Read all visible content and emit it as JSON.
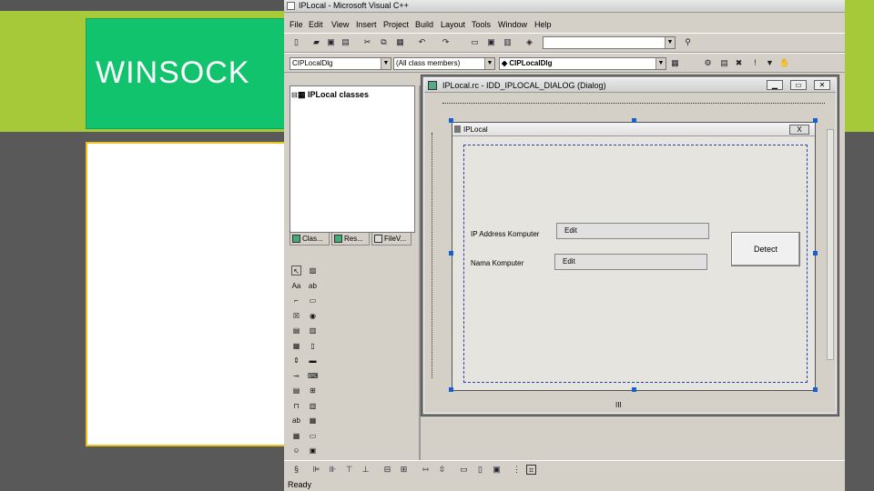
{
  "slide": {
    "title": "WINSOCK"
  },
  "app": {
    "title": "IPLocal - Microsoft Visual C++",
    "menu": [
      "File",
      "Edit",
      "View",
      "Insert",
      "Project",
      "Build",
      "Layout",
      "Tools",
      "Window",
      "Help"
    ],
    "toolbar2": {
      "class_combo": "CIPLocalDlg",
      "members_combo": "(All class members)",
      "method_combo": "CIPLocalDlg"
    },
    "workspace": {
      "tree_root": "IPLocal classes",
      "tabs": [
        "Clas...",
        "Res...",
        "FileV..."
      ]
    },
    "editor": {
      "doc_title": "IPLocal.rc - IDD_IPLOCAL_DIALOG (Dialog)",
      "hscroll_label": "III",
      "dialog": {
        "title": "IPLocal",
        "close_label": "X",
        "label_ip": "IP Address Komputer",
        "label_name": "Nama Komputer",
        "edit_ip": "Edit",
        "edit_name": "Edit",
        "button": "Detect"
      }
    },
    "status": "Ready"
  },
  "colors": {
    "green_band": "#a6c93a",
    "title_box": "#12c36e",
    "content_border": "#e8c21e"
  }
}
